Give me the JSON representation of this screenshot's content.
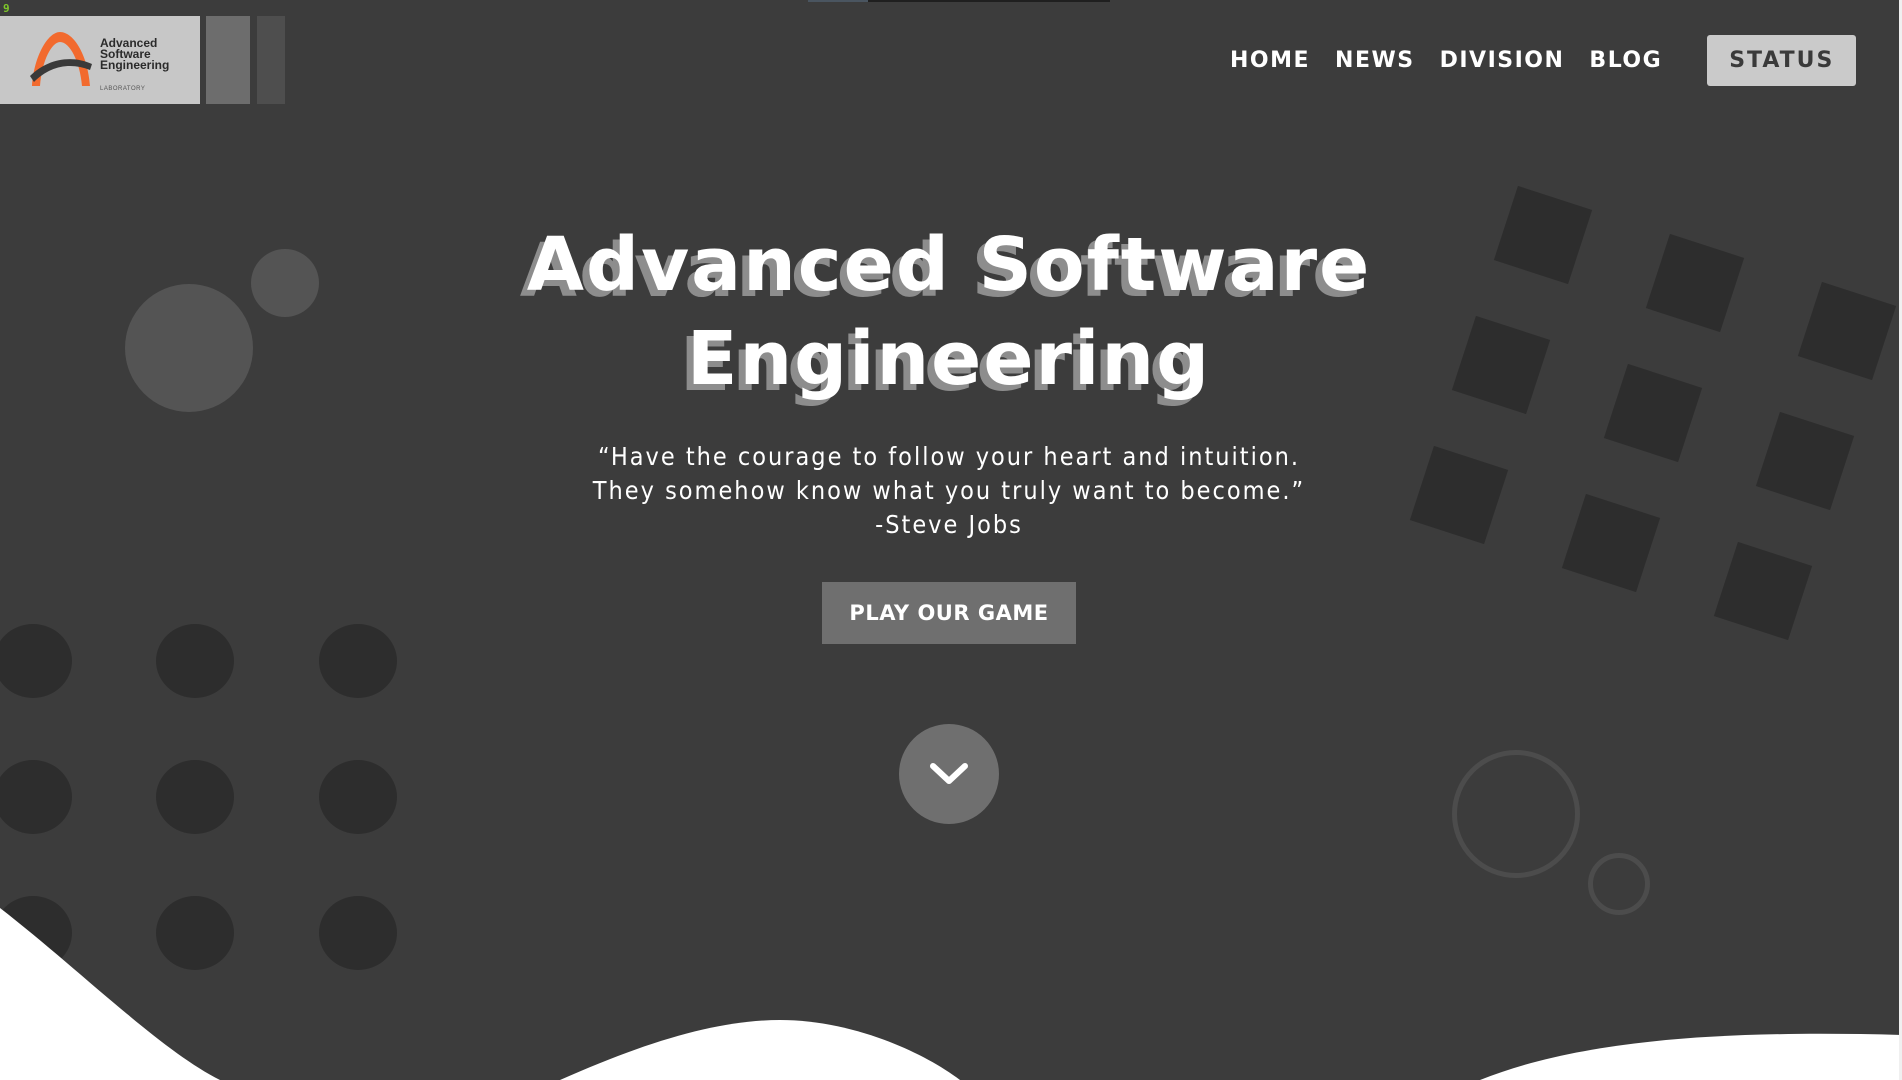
{
  "page": {
    "counter": "9"
  },
  "logo": {
    "line1": "Advanced",
    "line2": "Software",
    "line3": "Engineering",
    "subline": "LABORATORY",
    "brand_color": "#f26a2e"
  },
  "nav": {
    "items": [
      {
        "label": "HOME"
      },
      {
        "label": "NEWS"
      },
      {
        "label": "DIVISION"
      },
      {
        "label": "BLOG"
      }
    ],
    "status_label": "STATUS"
  },
  "hero": {
    "title_line1": "Advanced Software",
    "title_line2": "Engineering",
    "quote_line1": "“Have the courage to follow your heart and intuition.",
    "quote_line2": "They somehow know what you truly want to become.”",
    "quote_author": "-Steve Jobs",
    "cta_label": "PLAY OUR GAME",
    "scroll_icon": "chevron-down-icon"
  },
  "colors": {
    "background": "#3c3c3c",
    "button": "#6f6f6f",
    "status_button": "#cacaca",
    "title_shadow": "#8d8d8d",
    "decor_dark": "#2d2d2d",
    "decor_light": "#545454"
  }
}
